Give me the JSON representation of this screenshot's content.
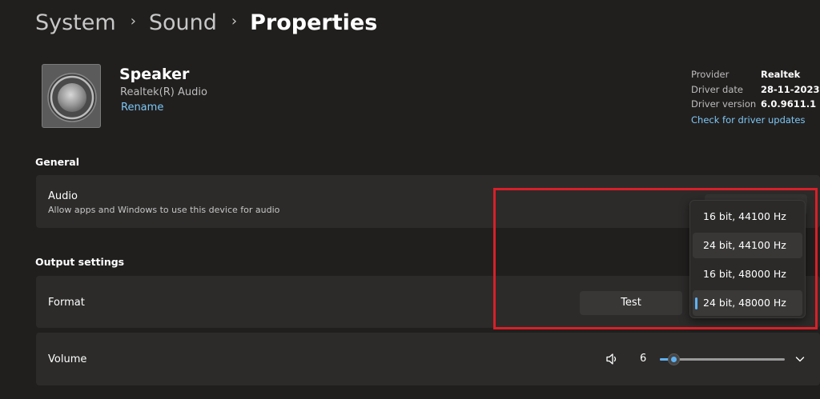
{
  "breadcrumb": {
    "items": [
      "System",
      "Sound",
      "Properties"
    ],
    "separator": "›"
  },
  "device": {
    "icon": "speaker-icon",
    "name": "Speaker",
    "subtitle": "Realtek(R) Audio",
    "rename_label": "Rename"
  },
  "driver": {
    "provider_label": "Provider",
    "provider_value": "Realtek",
    "date_label": "Driver date",
    "date_value": "28-11-2023",
    "version_label": "Driver version",
    "version_value": "6.0.9611.1",
    "update_link": "Check for driver updates"
  },
  "general": {
    "title": "General",
    "audio": {
      "title": "Audio",
      "description": "Allow apps and Windows to use this device for audio"
    }
  },
  "output": {
    "title": "Output settings",
    "format": {
      "title": "Format",
      "test_label": "Test",
      "options": [
        "16 bit, 44100 Hz",
        "24 bit, 44100 Hz",
        "16 bit, 48000 Hz",
        "24 bit, 48000 Hz"
      ],
      "selected_index": 3,
      "hover_index": 1
    },
    "volume": {
      "title": "Volume",
      "value": "6",
      "level_percent": 6,
      "icon": "speaker-volume-icon",
      "expand_icon": "chevron-down-icon"
    }
  },
  "colors": {
    "accent": "#5fb2f2",
    "link": "#7cc7f5",
    "highlight": "#d72028",
    "background": "#211f1e",
    "card": "#2c2b2a"
  }
}
